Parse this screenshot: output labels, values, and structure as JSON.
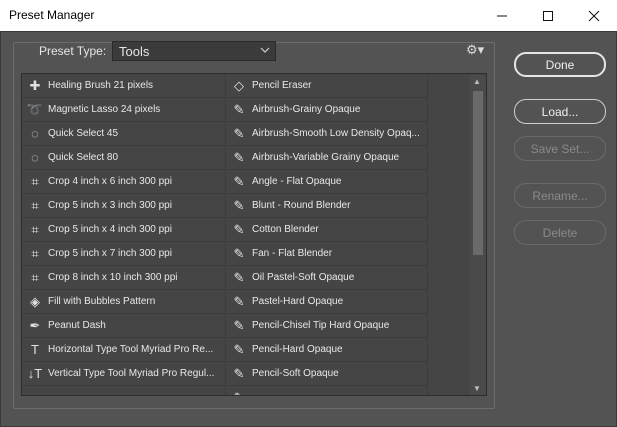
{
  "window": {
    "title": "Preset Manager"
  },
  "preset_type": {
    "label": "Preset Type:",
    "value": "Tools"
  },
  "list": {
    "left": [
      {
        "icon": "healing-brush-icon",
        "label": "Healing Brush 21 pixels"
      },
      {
        "icon": "magnetic-lasso-icon",
        "label": "Magnetic Lasso 24 pixels"
      },
      {
        "icon": "quick-select-icon",
        "label": "Quick Select 45"
      },
      {
        "icon": "quick-select-icon",
        "label": "Quick Select 80"
      },
      {
        "icon": "crop-icon",
        "label": "Crop 4 inch x 6 inch 300 ppi"
      },
      {
        "icon": "crop-icon",
        "label": "Crop 5 inch x 3 inch 300 ppi"
      },
      {
        "icon": "crop-icon",
        "label": "Crop 5 inch x 4 inch 300 ppi"
      },
      {
        "icon": "crop-icon",
        "label": "Crop 5 inch x 7 inch 300 ppi"
      },
      {
        "icon": "crop-icon",
        "label": "Crop 8 inch x 10 inch 300 ppi"
      },
      {
        "icon": "paint-bucket-icon",
        "label": "Fill with Bubbles Pattern"
      },
      {
        "icon": "pen-icon",
        "label": "Peanut Dash"
      },
      {
        "icon": "type-tool-icon",
        "label": "Horizontal Type Tool Myriad Pro Re..."
      },
      {
        "icon": "vertical-type-icon",
        "label": "Vertical Type Tool Myriad Pro Regul..."
      },
      {
        "icon": "rectangle-icon",
        "label": ""
      }
    ],
    "right": [
      {
        "icon": "eraser-icon",
        "label": "Pencil Eraser"
      },
      {
        "icon": "brush-icon",
        "label": "Airbrush-Grainy Opaque"
      },
      {
        "icon": "brush-icon",
        "label": "Airbrush-Smooth Low Density Opaq..."
      },
      {
        "icon": "brush-icon",
        "label": "Airbrush-Variable Grainy Opaque"
      },
      {
        "icon": "brush-icon",
        "label": "Angle - Flat Opaque"
      },
      {
        "icon": "brush-icon",
        "label": "Blunt - Round Blender"
      },
      {
        "icon": "brush-icon",
        "label": "Cotton Blender"
      },
      {
        "icon": "brush-icon",
        "label": "Fan - Flat Blender"
      },
      {
        "icon": "brush-icon",
        "label": "Oil Pastel-Soft Opaque"
      },
      {
        "icon": "brush-icon",
        "label": "Pastel-Hard Opaque"
      },
      {
        "icon": "brush-icon",
        "label": "Pencil-Chisel Tip Hard Opaque"
      },
      {
        "icon": "brush-icon",
        "label": "Pencil-Hard Opaque"
      },
      {
        "icon": "brush-icon",
        "label": "Pencil-Soft Opaque"
      },
      {
        "icon": "brush-icon",
        "label": ""
      }
    ]
  },
  "buttons": {
    "done": "Done",
    "load": "Load...",
    "save_set": "Save Set...",
    "rename": "Rename...",
    "delete": "Delete"
  }
}
